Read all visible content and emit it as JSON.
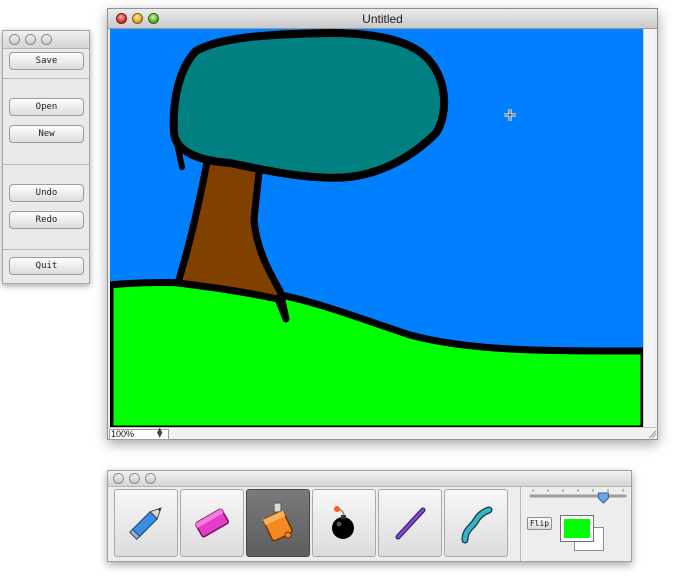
{
  "window": {
    "title": "Untitled",
    "zoom": "100%"
  },
  "commands": {
    "save": "Save",
    "open": "Open",
    "new": "New",
    "undo": "Undo",
    "redo": "Redo",
    "quit": "Quit"
  },
  "tools": [
    {
      "name": "pencil",
      "icon": "pencil-icon"
    },
    {
      "name": "eraser",
      "icon": "eraser-icon"
    },
    {
      "name": "paint bucket",
      "icon": "paint-bucket-icon",
      "selected": true
    },
    {
      "name": "bomb",
      "icon": "bomb-icon"
    },
    {
      "name": "line",
      "icon": "line-icon"
    },
    {
      "name": "brush",
      "icon": "brush-icon"
    }
  ],
  "controls": {
    "flip_label": "Flip",
    "brush_size_fraction": 0.77
  },
  "colors": {
    "foreground": "#00ff00",
    "background": "#ffffff",
    "sky": "#0080ff",
    "grass": "#00ff00",
    "foliage": "#008080",
    "trunk": "#804000",
    "outline": "#000000"
  }
}
